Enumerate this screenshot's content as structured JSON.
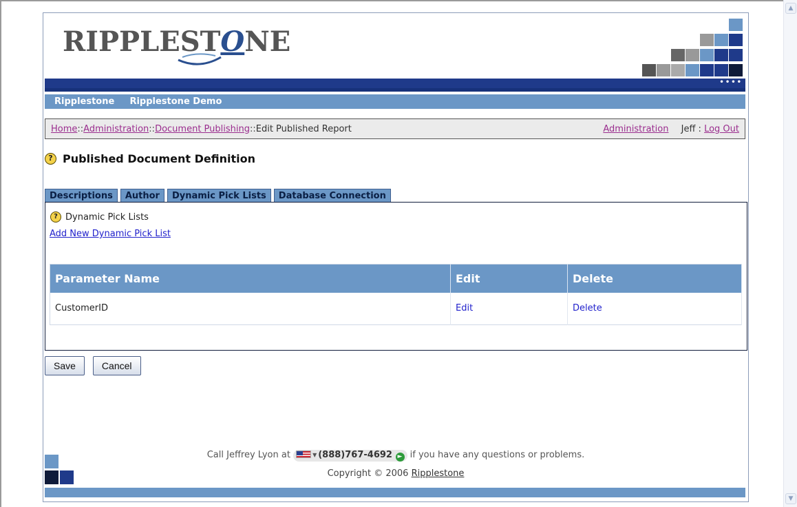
{
  "brand": {
    "logo_part1": "RIPPLEST",
    "logo_o": "O",
    "logo_part2": "NE",
    "colors": {
      "header_dark": "#1f3a8a",
      "nav": "#6b97c6",
      "link": "#2222cc",
      "visited": "#9a2d8e"
    }
  },
  "nav": {
    "items": [
      "Ripplestone",
      "Ripplestone Demo"
    ]
  },
  "breadcrumb": {
    "home": "Home",
    "administration": "Administration",
    "document_publishing": "Document Publishing",
    "sep": "::",
    "current": "Edit Published Report",
    "right_admin": "Administration",
    "user": "Jeff :",
    "logout": "Log Out"
  },
  "page": {
    "title": "Published Document Definition",
    "help_icon": "question-circle-icon"
  },
  "tabs": [
    {
      "label": "Descriptions"
    },
    {
      "label": "Author"
    },
    {
      "label": "Dynamic Pick Lists",
      "selected": true
    },
    {
      "label": "Database Connection"
    }
  ],
  "panel": {
    "subtitle": "Dynamic Pick Lists",
    "add_link": "Add New Dynamic Pick List",
    "columns": [
      "Parameter Name",
      "Edit",
      "Delete"
    ],
    "rows": [
      {
        "parameter": "CustomerID",
        "edit": "Edit",
        "delete": "Delete"
      }
    ]
  },
  "buttons": {
    "save": "Save",
    "cancel": "Cancel"
  },
  "footer": {
    "call_prefix": "Call Jeffrey Lyon at",
    "phone": "(888)767-4692",
    "call_suffix": "if you have any questions or problems.",
    "copyright": "Copyright © 2006",
    "company_link": "Ripplestone"
  }
}
